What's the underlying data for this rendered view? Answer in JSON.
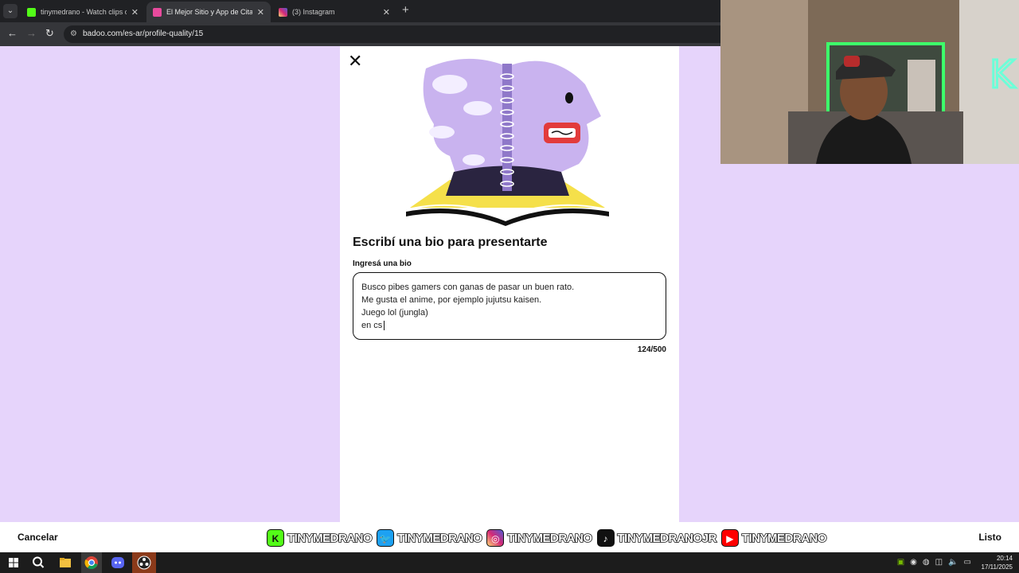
{
  "browser": {
    "tabs": [
      {
        "title": "tinymedrano - Watch clips on K",
        "active": false,
        "favicon_color": "#53fc18"
      },
      {
        "title": "El Mejor Sitio y App de Citas Gr",
        "active": true,
        "favicon_color": "#e84a9d"
      },
      {
        "title": "(3) Instagram",
        "active": false,
        "favicon_color": "#d6249f"
      }
    ],
    "url": "badoo.com/es-ar/profile-quality/15"
  },
  "page": {
    "heading": "Escribí una bio para presentarte",
    "field_label": "Ingresá una bio",
    "bio_lines": [
      "Busco pibes gamers con ganas de pasar un buen rato.",
      "Me gusta el anime, por ejemplo jujutsu kaisen.",
      "Juego lol (jungla)",
      "en cs"
    ],
    "char_count": "124/500"
  },
  "bottom_bar": {
    "cancel_label": "Cancelar",
    "done_label": "Listo",
    "social": [
      {
        "icon": "kick-icon",
        "glyph": "K",
        "color": "#53fc18",
        "handle": "TINYMEDRANO"
      },
      {
        "icon": "twitter-icon",
        "glyph": "🐦",
        "color": "#1da1f2",
        "handle": "TINYMEDRANO"
      },
      {
        "icon": "instagram-icon",
        "glyph": "◎",
        "color": "#d6249f",
        "handle": "TINYMEDRANO"
      },
      {
        "icon": "tiktok-icon",
        "glyph": "♪",
        "color": "#111111",
        "handle": "TINYMEDRANOJR"
      },
      {
        "icon": "youtube-icon",
        "glyph": "▶",
        "color": "#ff0000",
        "handle": "TINYMEDRANO"
      }
    ]
  },
  "taskbar": {
    "time": "20:14",
    "date": "17/11/2025"
  },
  "colors": {
    "page_background": "#e6d4fb",
    "panel": "#ffffff"
  }
}
